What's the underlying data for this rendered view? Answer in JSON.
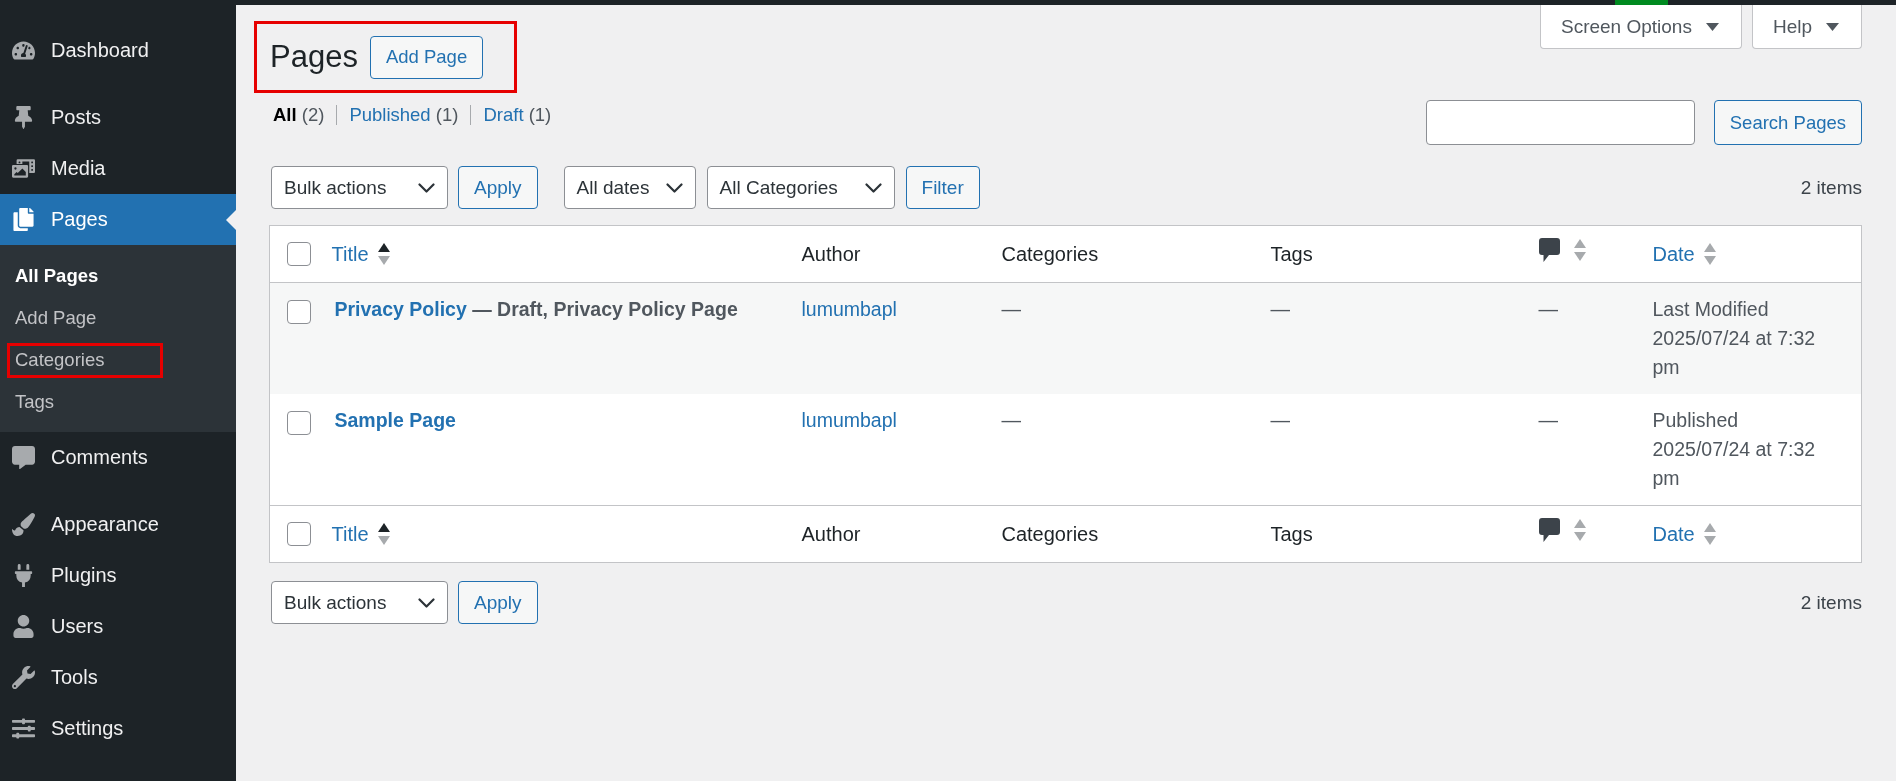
{
  "sidebar": {
    "groups": [
      {
        "items": [
          {
            "label": "Dashboard",
            "selected": false
          }
        ]
      },
      {
        "items": [
          {
            "label": "Posts",
            "selected": false
          },
          {
            "label": "Media",
            "selected": false
          },
          {
            "label": "Pages",
            "selected": true,
            "submenu": [
              {
                "label": "All Pages",
                "selected": true,
                "highlighted": false
              },
              {
                "label": "Add Page",
                "selected": false,
                "highlighted": false
              },
              {
                "label": "Categories",
                "selected": false,
                "highlighted": true
              },
              {
                "label": "Tags",
                "selected": false,
                "highlighted": false
              }
            ]
          },
          {
            "label": "Comments",
            "selected": false
          }
        ]
      },
      {
        "items": [
          {
            "label": "Appearance",
            "selected": false
          },
          {
            "label": "Plugins",
            "selected": false
          },
          {
            "label": "Users",
            "selected": false
          },
          {
            "label": "Tools",
            "selected": false
          },
          {
            "label": "Settings",
            "selected": false
          }
        ]
      }
    ]
  },
  "screen_tabs": [
    "Screen Options",
    "Help"
  ],
  "header": {
    "title": "Pages",
    "add_button": "Add Page",
    "highlighted": true
  },
  "views": [
    {
      "label": "All",
      "count": "(2)",
      "selected": true
    },
    {
      "label": "Published",
      "count": "(1)",
      "selected": false
    },
    {
      "label": "Draft",
      "count": "(1)",
      "selected": false
    }
  ],
  "search": {
    "button": "Search Pages"
  },
  "tablenav_top": {
    "bulk_action": "Bulk actions",
    "apply": "Apply",
    "filters": [
      "All dates",
      "All Categories"
    ],
    "filter_button": "Filter",
    "count": "2 items"
  },
  "table": {
    "header": [
      {
        "kind": "checkbox",
        "checked": false
      },
      {
        "kind": "sortable",
        "label": "Title",
        "sorted": true
      },
      {
        "kind": "plain",
        "label": "Author"
      },
      {
        "kind": "plain",
        "label": "Categories"
      },
      {
        "kind": "plain",
        "label": "Tags"
      },
      {
        "kind": "comments",
        "sorted": false
      },
      {
        "kind": "sortable",
        "label": "Date",
        "sorted": false
      }
    ],
    "rows": [
      {
        "checked": false,
        "title": "Privacy Policy",
        "post_state": "— Draft, Privacy Policy Page",
        "author": "lumumbapl",
        "categories": "—",
        "tags": "—",
        "comments": "—",
        "date_status": "Last Modified",
        "date": "2025/07/24 at 7:32 pm"
      },
      {
        "checked": false,
        "title": "Sample Page",
        "author": "lumumbapl",
        "categories": "—",
        "tags": "—",
        "comments": "—",
        "date_status": "Published",
        "date": "2025/07/24 at 7:32 pm"
      }
    ],
    "footer": [
      {
        "kind": "checkbox",
        "checked": false
      },
      {
        "kind": "sortable",
        "label": "Title",
        "sorted": true
      },
      {
        "kind": "plain",
        "label": "Author"
      },
      {
        "kind": "plain",
        "label": "Categories"
      },
      {
        "kind": "plain",
        "label": "Tags"
      },
      {
        "kind": "comments",
        "sorted": false
      },
      {
        "kind": "sortable",
        "label": "Date",
        "sorted": false
      }
    ]
  },
  "tablenav_bottom": {
    "bulk_action": "Bulk actions",
    "apply": "Apply",
    "count": "2 items"
  }
}
